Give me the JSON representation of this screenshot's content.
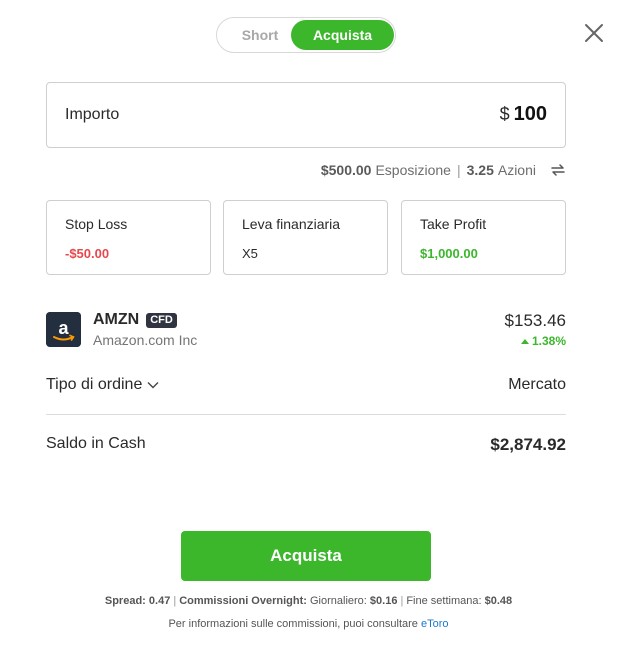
{
  "toggle": {
    "short_label": "Short",
    "buy_label": "Acquista"
  },
  "amount": {
    "label": "Importo",
    "currency": "$",
    "value": "100"
  },
  "exposure": {
    "exposure_value": "$500.00",
    "exposure_label": "Esposizione",
    "units_value": "3.25",
    "units_label": "Azioni",
    "icon": "swap-icon"
  },
  "stop_loss": {
    "label": "Stop Loss",
    "value": "-$50.00"
  },
  "leverage": {
    "label": "Leva finanziaria",
    "value": "X5"
  },
  "take_profit": {
    "label": "Take Profit",
    "value": "$1,000.00"
  },
  "instrument": {
    "symbol": "AMZN",
    "badge": "CFD",
    "name": "Amazon.com Inc",
    "price": "$153.46",
    "change": "1.38%",
    "logo_text": "a"
  },
  "order": {
    "label": "Tipo di ordine",
    "value": "Mercato"
  },
  "cash": {
    "label": "Saldo in Cash",
    "value": "$2,874.92"
  },
  "button": {
    "label": "Acquista"
  },
  "fees": {
    "spread_label": "Spread:",
    "spread_value": "0.47",
    "overnight_label": "Commissioni Overnight:",
    "daily_label": "Giornaliero:",
    "daily_value": "$0.16",
    "weekend_label": "Fine settimana:",
    "weekend_value": "$0.48"
  },
  "info": {
    "text": "Per informazioni sulle commissioni, puoi consultare",
    "link": "eToro"
  },
  "colors": {
    "accent": "#3cb72c",
    "negative": "#e5484d",
    "link": "#1b78d0"
  }
}
